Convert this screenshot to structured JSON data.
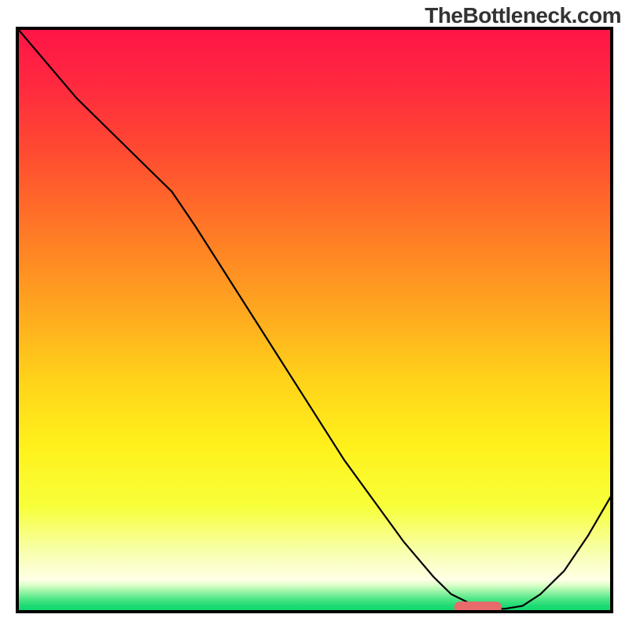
{
  "watermark": "TheBottleneck.com",
  "chart_data": {
    "type": "line",
    "title": "",
    "xlabel": "",
    "ylabel": "",
    "xlim": [
      0,
      100
    ],
    "ylim": [
      0,
      100
    ],
    "x": [
      0,
      5,
      10,
      15,
      20,
      23,
      26,
      30,
      35,
      40,
      45,
      50,
      55,
      60,
      65,
      70,
      73,
      76,
      80,
      82,
      85,
      88,
      92,
      96,
      100
    ],
    "values": [
      100,
      94,
      88,
      83,
      78,
      75,
      72,
      66,
      58,
      50,
      42,
      34,
      26,
      19,
      12,
      6,
      3,
      1.5,
      0.5,
      0.5,
      1,
      3,
      7,
      13,
      20
    ],
    "gradient_stops": [
      {
        "offset": 0.0,
        "color": "#ff1447"
      },
      {
        "offset": 0.1,
        "color": "#ff2a3f"
      },
      {
        "offset": 0.22,
        "color": "#ff4d30"
      },
      {
        "offset": 0.35,
        "color": "#ff7a26"
      },
      {
        "offset": 0.48,
        "color": "#ffa61f"
      },
      {
        "offset": 0.6,
        "color": "#ffd21a"
      },
      {
        "offset": 0.72,
        "color": "#fff21c"
      },
      {
        "offset": 0.82,
        "color": "#f7ff3a"
      },
      {
        "offset": 0.9,
        "color": "#f8ffb0"
      },
      {
        "offset": 0.945,
        "color": "#ffffe6"
      },
      {
        "offset": 0.955,
        "color": "#d8ffc8"
      },
      {
        "offset": 0.965,
        "color": "#9cf5a8"
      },
      {
        "offset": 0.978,
        "color": "#4fe786"
      },
      {
        "offset": 0.99,
        "color": "#1edb74"
      },
      {
        "offset": 1.0,
        "color": "#0fd66c"
      }
    ],
    "target_marker": {
      "x0": 73.5,
      "x1": 81.5,
      "y": 0.8,
      "color": "#e86a6a"
    },
    "border_color": "#000000",
    "border_width": 4
  }
}
